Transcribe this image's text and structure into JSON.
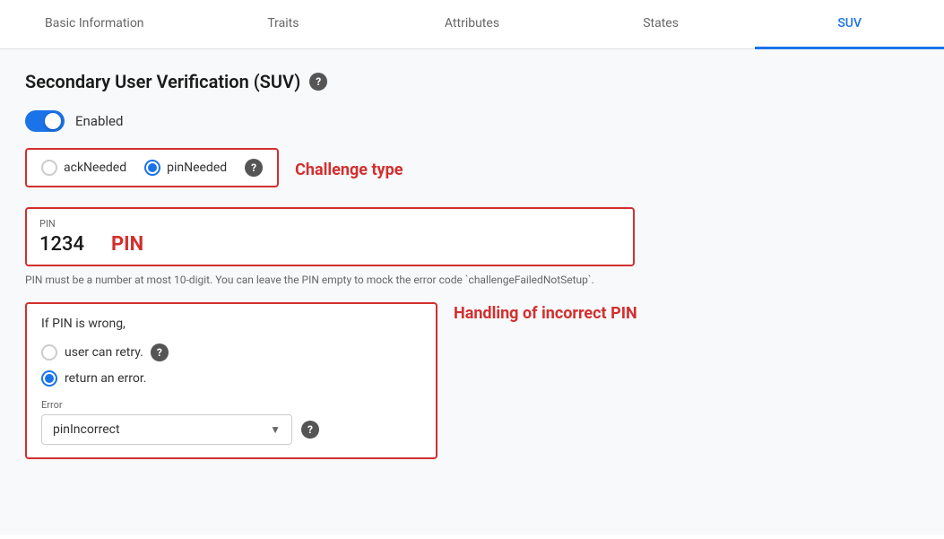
{
  "tabs": [
    {
      "id": "basic-information",
      "label": "Basic Information",
      "active": false
    },
    {
      "id": "traits",
      "label": "Traits",
      "active": false
    },
    {
      "id": "attributes",
      "label": "Attributes",
      "active": false
    },
    {
      "id": "states",
      "label": "States",
      "active": false
    },
    {
      "id": "suv",
      "label": "SUV",
      "active": true
    }
  ],
  "section": {
    "title": "Secondary User Verification (SUV)",
    "help_icon": "?"
  },
  "toggle": {
    "enabled": true,
    "label": "Enabled"
  },
  "challenge_type": {
    "label": "Challenge type",
    "options": [
      {
        "id": "ackNeeded",
        "label": "ackNeeded",
        "selected": false
      },
      {
        "id": "pinNeeded",
        "label": "pinNeeded",
        "selected": true
      }
    ],
    "help_icon": "?"
  },
  "pin_field": {
    "label": "PIN",
    "value": "1234",
    "big_label": "PIN",
    "hint": "PIN must be a number at most 10-digit. You can leave the PIN empty to mock the error code `challengeFailedNotSetup`."
  },
  "incorrect_pin": {
    "title": "If PIN is wrong,",
    "side_label": "Handling of incorrect PIN",
    "options": [
      {
        "id": "retry",
        "label": "user can retry.",
        "selected": false
      },
      {
        "id": "error",
        "label": "return an error.",
        "selected": true
      }
    ],
    "retry_help_icon": "?",
    "error_dropdown": {
      "label": "Error",
      "value": "pinIncorrect",
      "help_icon": "?"
    }
  }
}
